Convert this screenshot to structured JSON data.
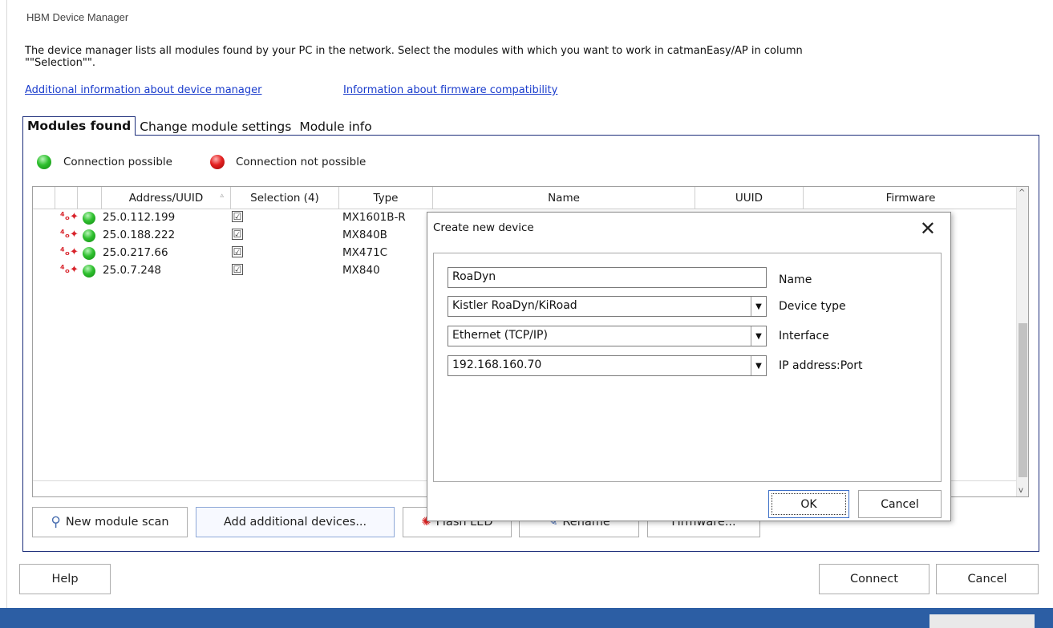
{
  "window": {
    "title": "HBM Device Manager"
  },
  "description": "The device manager lists all modules found by your PC in the network. Select the modules with which you want to work in catmanEasy/AP in column\n\"\"Selection\"\".",
  "links": {
    "device_manager": "Additional information about device manager",
    "firmware": "Information about firmware compatibility"
  },
  "tabs": [
    {
      "label": "Modules found",
      "active": true
    },
    {
      "label": "Change module settings"
    },
    {
      "label": "Module info"
    }
  ],
  "legend": {
    "possible": "Connection possible",
    "not_possible": "Connection not possible"
  },
  "columns": {
    "address": "Address/UUID",
    "selection": "Selection (4)",
    "type": "Type",
    "name": "Name",
    "uuid": "UUID",
    "firmware": "Firmware"
  },
  "modules": [
    {
      "address": "25.0.112.199",
      "selected": "☑",
      "type": "MX1601B-R"
    },
    {
      "address": "25.0.188.222",
      "selected": "☑",
      "type": "MX840B"
    },
    {
      "address": "25.0.217.66",
      "selected": "☑",
      "type": "MX471C"
    },
    {
      "address": "25.0.7.248",
      "selected": "☑",
      "type": "MX840"
    }
  ],
  "buttons": {
    "new_scan": "New module scan",
    "add_devices": "Add additional devices...",
    "flash_led": "Flash LED",
    "rename": "Rename",
    "firmware": "Firmware...",
    "help": "Help",
    "connect": "Connect",
    "cancel": "Cancel"
  },
  "dialog": {
    "title": "Create new device",
    "close": "✕",
    "name_value": "RoaDyn",
    "name_label": "Name",
    "device_type_value": "Kistler RoaDyn/KiRoad",
    "device_type_label": "Device type",
    "interface_value": "Ethernet (TCP/IP)",
    "interface_label": "Interface",
    "ip_value": "192.168.160.70",
    "ip_label": "IP address:Port",
    "ok": "OK",
    "cancel": "Cancel"
  },
  "icons": {
    "connection_ok": "green-ball-icon",
    "connection_failed": "red-ball-icon",
    "device": "device-signal-icon",
    "search": "magnifier-icon",
    "led": "led-flash-icon",
    "rename": "rename-icon"
  },
  "colors": {
    "link": "#1a3ccc",
    "panel_border": "#1c2d7a",
    "taskbar": "#2c5ea4",
    "ok_green": "#2fc02f",
    "fail_red": "#e42020"
  }
}
